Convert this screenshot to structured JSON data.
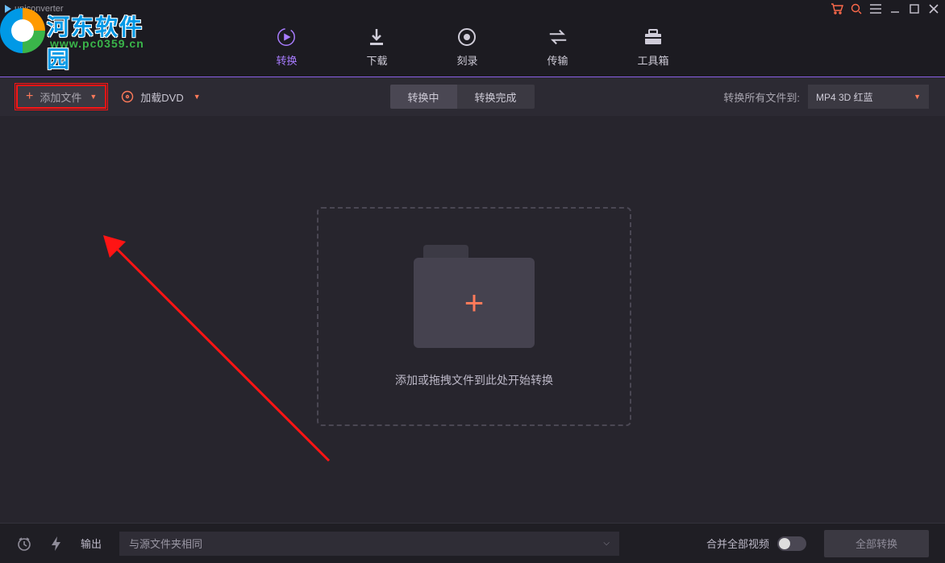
{
  "app": {
    "title": "uniconverter"
  },
  "watermark": {
    "text": "河东软件园",
    "url": "www.pc0359.cn"
  },
  "nav": {
    "convert": "转换",
    "download": "下载",
    "burn": "刻录",
    "transfer": "传输",
    "toolbox": "工具箱"
  },
  "toolbar": {
    "add_file": "添加文件",
    "load_dvd": "加载DVD",
    "tab_converting": "转换中",
    "tab_done": "转换完成",
    "convert_all_to": "转换所有文件到:",
    "format_selected": "MP4 3D 红蓝"
  },
  "dropzone": {
    "hint": "添加或拖拽文件到此处开始转换"
  },
  "footer": {
    "output_label": "输出",
    "output_value": "与源文件夹相同",
    "merge_label": "合并全部视频",
    "convert_all": "全部转换"
  }
}
